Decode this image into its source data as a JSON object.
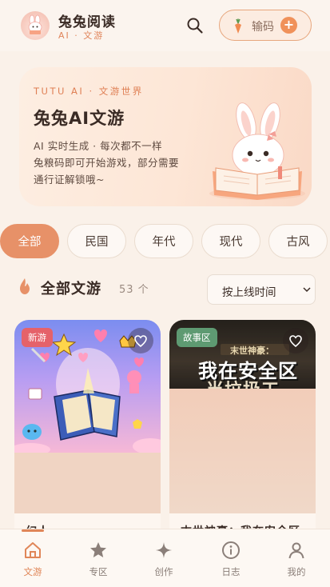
{
  "header": {
    "brand_title": "兔兔阅读",
    "brand_sub": "AI · 文游",
    "code_button_label": "输码"
  },
  "hero": {
    "tag": "TUTU AI · 文游世界",
    "title": "兔兔AI文游",
    "desc_line1": "AI 实时生成 · 每次都不一样",
    "desc_line2": "兔粮码即可开始游戏，部分需要",
    "desc_line3": "通行证解锁哦~"
  },
  "filters": [
    {
      "label": "全部",
      "active": true
    },
    {
      "label": "民国",
      "active": false
    },
    {
      "label": "年代",
      "active": false
    },
    {
      "label": "现代",
      "active": false
    },
    {
      "label": "古风",
      "active": false
    }
  ],
  "section": {
    "title": "全部文游",
    "count": "53 个",
    "sort_selected": "按上线时间"
  },
  "cards": [
    {
      "badge": "新游",
      "badge_color": "#e5626a",
      "title": "幻人"
    },
    {
      "badge": "故事区",
      "badge_color": "#5e9a72",
      "title": "末世神豪：我在安全区",
      "cover_text_1": "末世神豪：",
      "cover_text_2": "我在安全区",
      "cover_text_3": "当垃圾工"
    }
  ],
  "tabs": [
    {
      "label": "文游",
      "icon": "home-icon",
      "active": true
    },
    {
      "label": "专区",
      "icon": "star-icon",
      "active": false
    },
    {
      "label": "创作",
      "icon": "sparkle-icon",
      "active": false
    },
    {
      "label": "日志",
      "icon": "info-icon",
      "active": false
    },
    {
      "label": "我的",
      "icon": "user-icon",
      "active": false
    }
  ],
  "colors": {
    "accent": "#e79168",
    "background": "#faf1e9",
    "new_badge": "#e5626a",
    "story_badge": "#5e9a72"
  }
}
